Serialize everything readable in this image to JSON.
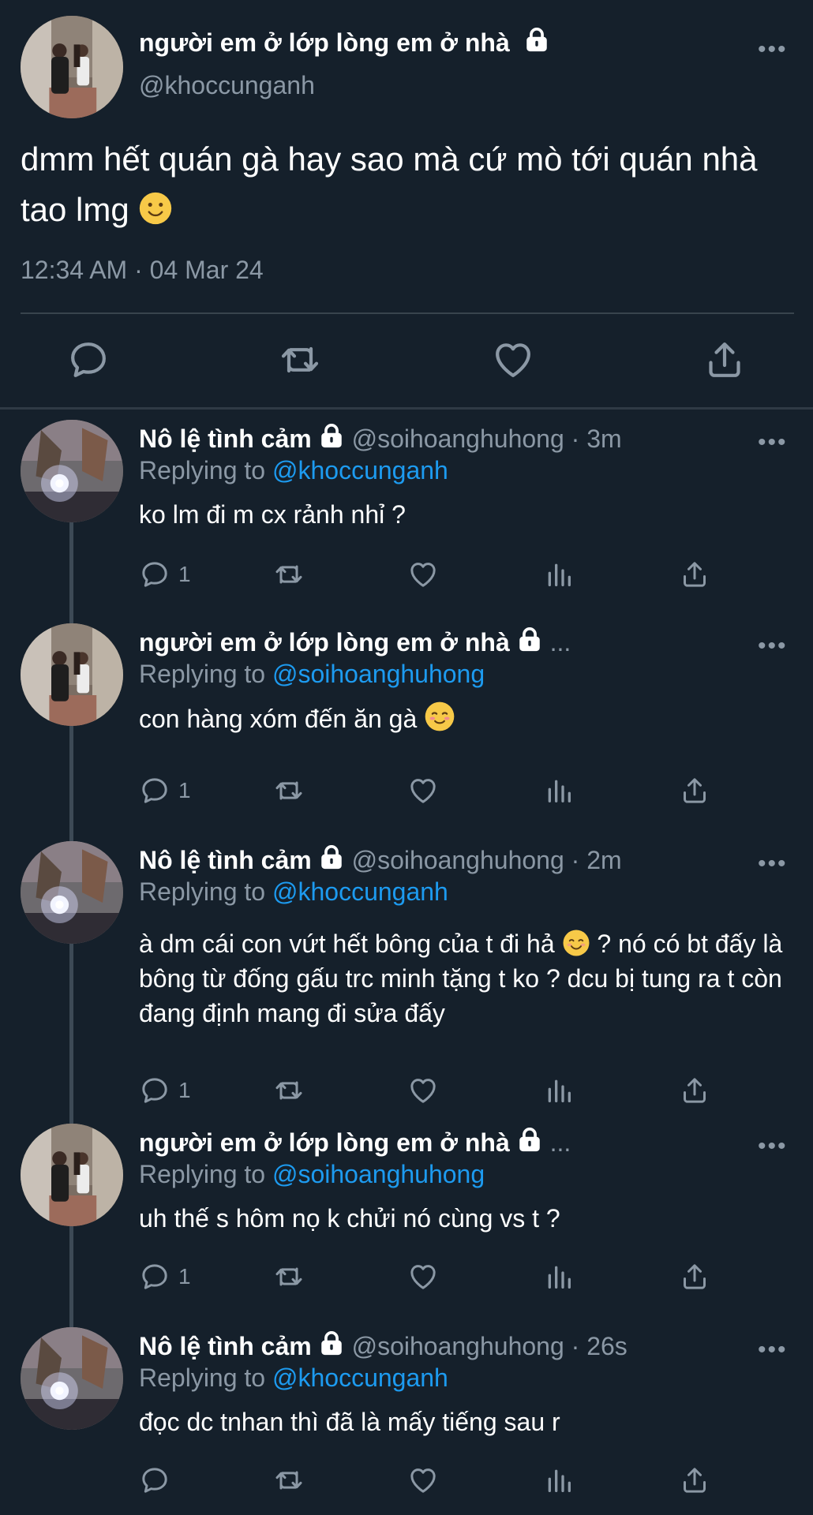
{
  "main": {
    "display_name": "người em ở lớp lòng em ở nhà",
    "handle": "@khoccunganh",
    "text": "dmm hết quán gà hay sao mà cứ mò tới quán nhà tao lmg",
    "timestamp": "12:34 AM · 04 Mar 24",
    "more": "•••"
  },
  "replies": [
    {
      "display_name": "Nô lệ tình cảm",
      "meta": "@soihoanghuhong · 3m",
      "replying_label": "Replying to",
      "replying_to": "@khoccunganh",
      "text": "ko lm đi m cx rảnh nhỉ ?",
      "reply_count": "1",
      "more": "•••"
    },
    {
      "display_name": "người em ở lớp lòng em ở nhà",
      "meta": "...",
      "replying_label": "Replying to",
      "replying_to": "@soihoanghuhong",
      "text": "con hàng xóm đến ăn gà",
      "reply_count": "1",
      "more": "•••"
    },
    {
      "display_name": "Nô lệ tình cảm",
      "meta": "@soihoanghuhong · 2m",
      "replying_label": "Replying to",
      "replying_to": "@khoccunganh",
      "text_a": "à dm cái con vứt hết bông của t đi hả",
      "text_b": "? nó có bt đấy là bông từ đống gấu trc minh tặng t ko ? dcu bị tung ra t còn đang định mang đi sửa đấy",
      "reply_count": "1",
      "more": "•••"
    },
    {
      "display_name": "người em ở lớp lòng em ở nhà",
      "meta": "...",
      "replying_label": "Replying to",
      "replying_to": "@soihoanghuhong",
      "text": "uh thế s hôm nọ k chửi nó cùng vs t ?",
      "reply_count": "1",
      "more": "•••"
    },
    {
      "display_name": "Nô lệ tình cảm",
      "meta": "@soihoanghuhong · 26s",
      "replying_label": "Replying to",
      "replying_to": "@khoccunganh",
      "text": "đọc dc tnhan thì đã là mấy tiếng sau r",
      "reply_count": "",
      "more": "•••"
    }
  ],
  "icons": {
    "reply": "speech-bubble-icon",
    "retweet": "retweet-icon",
    "like": "heart-icon",
    "views": "bar-chart-icon",
    "share": "share-upload-icon",
    "lock": "lock-icon"
  },
  "colors": {
    "background": "#15202b",
    "accent": "#1d9bf0",
    "muted": "#8b98a5",
    "divider": "#38444d"
  }
}
